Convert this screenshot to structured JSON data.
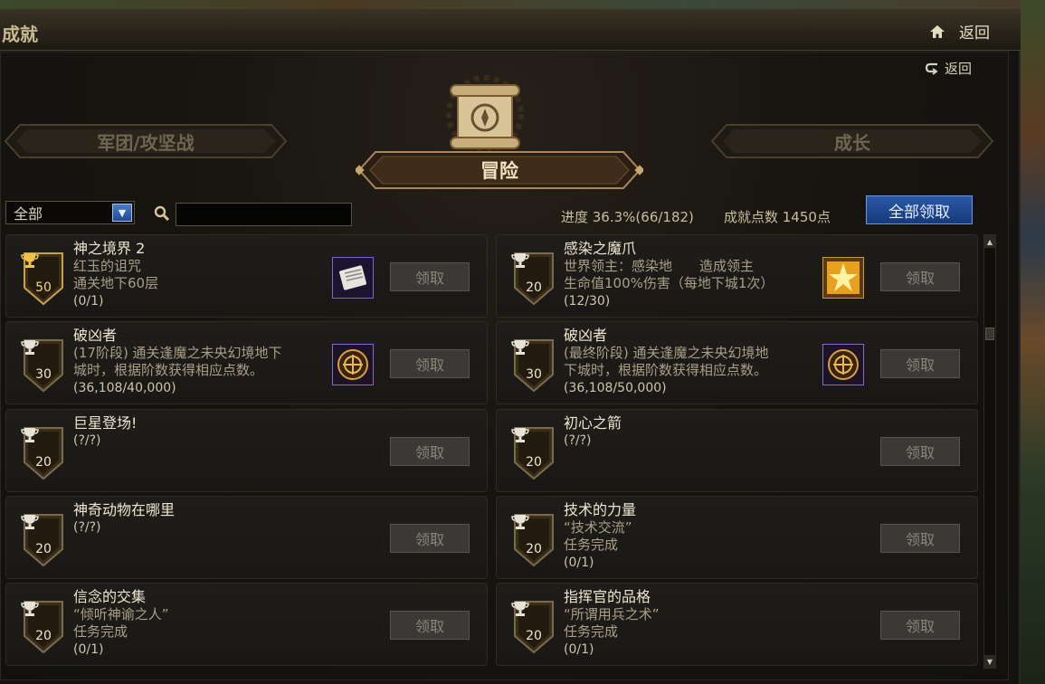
{
  "window": {
    "title": "成就",
    "home_label": "返回",
    "back_label": "返回"
  },
  "tabs": {
    "left": "军团/攻坚战",
    "center": "冒险",
    "right": "成长"
  },
  "filter": {
    "selected": "全部",
    "search_placeholder": ""
  },
  "summary": {
    "progress": "进度 36.3%(66/182)",
    "points": "成就点数 1450点",
    "claim_all": "全部领取"
  },
  "claim_label": "领取",
  "cards": [
    {
      "points": "50",
      "tier": "gold",
      "name": "神之境界 2",
      "lines": [
        "红玉的诅咒",
        "通关地下60层"
      ],
      "count": "(0/1)",
      "reward": "scroll-icon"
    },
    {
      "points": "20",
      "tier": "silver",
      "name": "感染之魔爪",
      "lines": [
        "世界领主：感染地　　造成领主",
        "生命值100%伤害（每地下城1次）"
      ],
      "count": "(12/30)",
      "reward": "gold-star-icon"
    },
    {
      "points": "30",
      "tier": "silver",
      "name": "破凶者",
      "lines": [
        "(17阶段) 通关逢魔之未央幻境地下",
        "城时，根据阶数获得相应点数。"
      ],
      "count": "(36,108/40,000)",
      "reward": "emblem-icon"
    },
    {
      "points": "30",
      "tier": "silver",
      "name": "破凶者",
      "lines": [
        "(最终阶段) 通关逢魔之未央幻境地",
        "下城时，根据阶数获得相应点数。"
      ],
      "count": "(36,108/50,000)",
      "reward": "emblem-icon"
    },
    {
      "points": "20",
      "tier": "silver",
      "name": "巨星登场!",
      "lines": [],
      "count": "(?/?)",
      "reward": ""
    },
    {
      "points": "20",
      "tier": "silver",
      "name": "初心之箭",
      "lines": [],
      "count": "(?/?)",
      "reward": ""
    },
    {
      "points": "20",
      "tier": "silver",
      "name": "神奇动物在哪里",
      "lines": [],
      "count": "(?/?)",
      "reward": ""
    },
    {
      "points": "20",
      "tier": "silver",
      "name": "技术的力量",
      "lines": [
        "“技术交流”",
        "任务完成"
      ],
      "count": "(0/1)",
      "reward": ""
    },
    {
      "points": "20",
      "tier": "silver",
      "name": "信念的交集",
      "lines": [
        "“倾听神谕之人”",
        "任务完成"
      ],
      "count": "(0/1)",
      "reward": ""
    },
    {
      "points": "20",
      "tier": "silver",
      "name": "指挥官的品格",
      "lines": [
        "“所谓用兵之术”",
        "任务完成"
      ],
      "count": "(0/1)",
      "reward": ""
    }
  ],
  "colors": {
    "accent_blue": "#1f4a92",
    "gold_text": "#f5d77a",
    "frame_gold": "#8a7a5a"
  }
}
